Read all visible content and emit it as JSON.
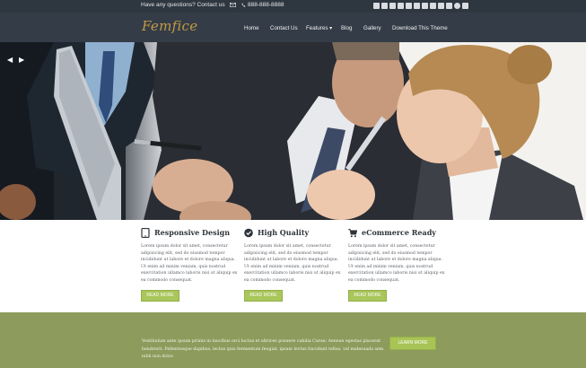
{
  "topbar": {
    "question": "Have any questions? Contact us",
    "phone": "888-888-8888",
    "mail_icon": "mail-icon",
    "phone_icon": "phone-icon",
    "social_icons": [
      "facebook-icon",
      "flickr-icon",
      "twitter-icon",
      "rss-icon",
      "linkedin-icon",
      "tumblr-icon",
      "vimeo-icon",
      "delicious-icon",
      "stumbleupon-icon",
      "google-plus-icon",
      "pinterest-icon",
      "youtube-icon"
    ]
  },
  "header": {
    "logo": "Femfice",
    "nav": [
      {
        "label": "Home"
      },
      {
        "label": "Contact Us"
      },
      {
        "label": "Features ▾"
      },
      {
        "label": "Blog"
      },
      {
        "label": "Gallery"
      },
      {
        "label": "Download This Theme"
      }
    ]
  },
  "hero": {
    "prev_arrow": "◀",
    "next_arrow": "▶"
  },
  "features": [
    {
      "icon": "tablet-icon",
      "title": "Responsive Design",
      "text": "Lorem ipsum dolor sit amet, consectetur adipisicing elit, sed do eiusmod tempor incididunt ut labore et dolore magna aliqua. Ut enim ad minim veniam, quis nostrud exercitation ullamco laboris nisi ut aliquip ex ea commodo consequat.",
      "button": "READ MORE"
    },
    {
      "icon": "check-circle-icon",
      "title": "High Quality",
      "text": "Lorem ipsum dolor sit amet, consectetur adipisicing elit, sed do eiusmod tempor incididunt ut labore et dolore magna aliqua. Ut enim ad minim veniam, quis nostrud exercitation ullamco laboris nisi ut aliquip ex ea commodo consequat.",
      "button": "READ MORE"
    },
    {
      "icon": "shopping-cart-icon",
      "title": "eCommerce Ready",
      "text": "Lorem ipsum dolor sit amet, consectetur adipisicing elit, sed do eiusmod tempor incididunt ut labore et dolore magna aliqua. Ut enim ad minim veniam, quis nostrud exercitation ullamco laboris nisi ut aliquip ex ea commodo consequat.",
      "button": "READ MORE"
    }
  ],
  "band": {
    "text": "Vestibulum ante ipsum primis in faucibus orci luctus et ultrices posuere cubilia Curae; Aenean egestas placerat hendrerit. Pellentesque dapibus, lectus quis fermentum feugiat, ipsum lectus tincidunt tellus, vel malesuada sem nibh non dolor.",
    "button": "LEARN MORE"
  },
  "colors": {
    "topbar_bg": "#2e3640",
    "header_bg": "#343d47",
    "logo": "#c59a45",
    "button_green": "#a8c65a",
    "band_bg": "#8d9b5c"
  }
}
